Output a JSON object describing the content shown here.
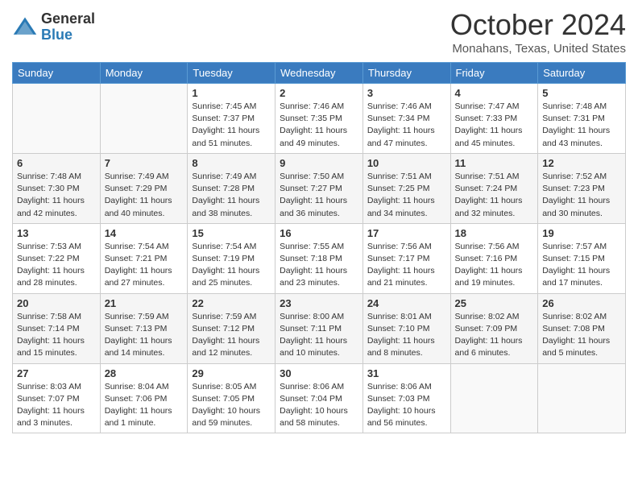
{
  "header": {
    "logo": {
      "general": "General",
      "blue": "Blue"
    },
    "title": "October 2024",
    "location": "Monahans, Texas, United States"
  },
  "weekdays": [
    "Sunday",
    "Monday",
    "Tuesday",
    "Wednesday",
    "Thursday",
    "Friday",
    "Saturday"
  ],
  "weeks": [
    [
      {
        "day": "",
        "sunrise": "",
        "sunset": "",
        "daylight": ""
      },
      {
        "day": "",
        "sunrise": "",
        "sunset": "",
        "daylight": ""
      },
      {
        "day": "1",
        "sunrise": "Sunrise: 7:45 AM",
        "sunset": "Sunset: 7:37 PM",
        "daylight": "Daylight: 11 hours and 51 minutes."
      },
      {
        "day": "2",
        "sunrise": "Sunrise: 7:46 AM",
        "sunset": "Sunset: 7:35 PM",
        "daylight": "Daylight: 11 hours and 49 minutes."
      },
      {
        "day": "3",
        "sunrise": "Sunrise: 7:46 AM",
        "sunset": "Sunset: 7:34 PM",
        "daylight": "Daylight: 11 hours and 47 minutes."
      },
      {
        "day": "4",
        "sunrise": "Sunrise: 7:47 AM",
        "sunset": "Sunset: 7:33 PM",
        "daylight": "Daylight: 11 hours and 45 minutes."
      },
      {
        "day": "5",
        "sunrise": "Sunrise: 7:48 AM",
        "sunset": "Sunset: 7:31 PM",
        "daylight": "Daylight: 11 hours and 43 minutes."
      }
    ],
    [
      {
        "day": "6",
        "sunrise": "Sunrise: 7:48 AM",
        "sunset": "Sunset: 7:30 PM",
        "daylight": "Daylight: 11 hours and 42 minutes."
      },
      {
        "day": "7",
        "sunrise": "Sunrise: 7:49 AM",
        "sunset": "Sunset: 7:29 PM",
        "daylight": "Daylight: 11 hours and 40 minutes."
      },
      {
        "day": "8",
        "sunrise": "Sunrise: 7:49 AM",
        "sunset": "Sunset: 7:28 PM",
        "daylight": "Daylight: 11 hours and 38 minutes."
      },
      {
        "day": "9",
        "sunrise": "Sunrise: 7:50 AM",
        "sunset": "Sunset: 7:27 PM",
        "daylight": "Daylight: 11 hours and 36 minutes."
      },
      {
        "day": "10",
        "sunrise": "Sunrise: 7:51 AM",
        "sunset": "Sunset: 7:25 PM",
        "daylight": "Daylight: 11 hours and 34 minutes."
      },
      {
        "day": "11",
        "sunrise": "Sunrise: 7:51 AM",
        "sunset": "Sunset: 7:24 PM",
        "daylight": "Daylight: 11 hours and 32 minutes."
      },
      {
        "day": "12",
        "sunrise": "Sunrise: 7:52 AM",
        "sunset": "Sunset: 7:23 PM",
        "daylight": "Daylight: 11 hours and 30 minutes."
      }
    ],
    [
      {
        "day": "13",
        "sunrise": "Sunrise: 7:53 AM",
        "sunset": "Sunset: 7:22 PM",
        "daylight": "Daylight: 11 hours and 28 minutes."
      },
      {
        "day": "14",
        "sunrise": "Sunrise: 7:54 AM",
        "sunset": "Sunset: 7:21 PM",
        "daylight": "Daylight: 11 hours and 27 minutes."
      },
      {
        "day": "15",
        "sunrise": "Sunrise: 7:54 AM",
        "sunset": "Sunset: 7:19 PM",
        "daylight": "Daylight: 11 hours and 25 minutes."
      },
      {
        "day": "16",
        "sunrise": "Sunrise: 7:55 AM",
        "sunset": "Sunset: 7:18 PM",
        "daylight": "Daylight: 11 hours and 23 minutes."
      },
      {
        "day": "17",
        "sunrise": "Sunrise: 7:56 AM",
        "sunset": "Sunset: 7:17 PM",
        "daylight": "Daylight: 11 hours and 21 minutes."
      },
      {
        "day": "18",
        "sunrise": "Sunrise: 7:56 AM",
        "sunset": "Sunset: 7:16 PM",
        "daylight": "Daylight: 11 hours and 19 minutes."
      },
      {
        "day": "19",
        "sunrise": "Sunrise: 7:57 AM",
        "sunset": "Sunset: 7:15 PM",
        "daylight": "Daylight: 11 hours and 17 minutes."
      }
    ],
    [
      {
        "day": "20",
        "sunrise": "Sunrise: 7:58 AM",
        "sunset": "Sunset: 7:14 PM",
        "daylight": "Daylight: 11 hours and 15 minutes."
      },
      {
        "day": "21",
        "sunrise": "Sunrise: 7:59 AM",
        "sunset": "Sunset: 7:13 PM",
        "daylight": "Daylight: 11 hours and 14 minutes."
      },
      {
        "day": "22",
        "sunrise": "Sunrise: 7:59 AM",
        "sunset": "Sunset: 7:12 PM",
        "daylight": "Daylight: 11 hours and 12 minutes."
      },
      {
        "day": "23",
        "sunrise": "Sunrise: 8:00 AM",
        "sunset": "Sunset: 7:11 PM",
        "daylight": "Daylight: 11 hours and 10 minutes."
      },
      {
        "day": "24",
        "sunrise": "Sunrise: 8:01 AM",
        "sunset": "Sunset: 7:10 PM",
        "daylight": "Daylight: 11 hours and 8 minutes."
      },
      {
        "day": "25",
        "sunrise": "Sunrise: 8:02 AM",
        "sunset": "Sunset: 7:09 PM",
        "daylight": "Daylight: 11 hours and 6 minutes."
      },
      {
        "day": "26",
        "sunrise": "Sunrise: 8:02 AM",
        "sunset": "Sunset: 7:08 PM",
        "daylight": "Daylight: 11 hours and 5 minutes."
      }
    ],
    [
      {
        "day": "27",
        "sunrise": "Sunrise: 8:03 AM",
        "sunset": "Sunset: 7:07 PM",
        "daylight": "Daylight: 11 hours and 3 minutes."
      },
      {
        "day": "28",
        "sunrise": "Sunrise: 8:04 AM",
        "sunset": "Sunset: 7:06 PM",
        "daylight": "Daylight: 11 hours and 1 minute."
      },
      {
        "day": "29",
        "sunrise": "Sunrise: 8:05 AM",
        "sunset": "Sunset: 7:05 PM",
        "daylight": "Daylight: 10 hours and 59 minutes."
      },
      {
        "day": "30",
        "sunrise": "Sunrise: 8:06 AM",
        "sunset": "Sunset: 7:04 PM",
        "daylight": "Daylight: 10 hours and 58 minutes."
      },
      {
        "day": "31",
        "sunrise": "Sunrise: 8:06 AM",
        "sunset": "Sunset: 7:03 PM",
        "daylight": "Daylight: 10 hours and 56 minutes."
      },
      {
        "day": "",
        "sunrise": "",
        "sunset": "",
        "daylight": ""
      },
      {
        "day": "",
        "sunrise": "",
        "sunset": "",
        "daylight": ""
      }
    ]
  ]
}
